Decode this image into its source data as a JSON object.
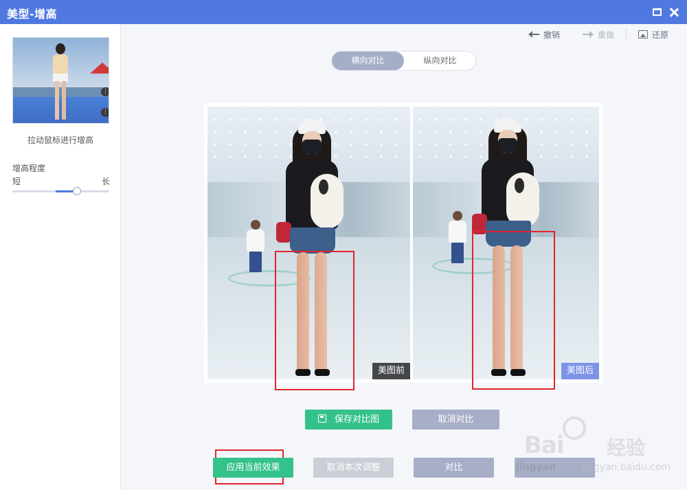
{
  "window": {
    "title": "美型-增高"
  },
  "sidebar": {
    "hint": "拉动鼠标进行增高",
    "degree_label": "增高程度",
    "short_label": "短",
    "long_label": "长",
    "slider_value": 0.68
  },
  "toolbar": {
    "undo": "撤销",
    "redo": "重做",
    "restore": "还原"
  },
  "compare_mode": {
    "horizontal": "横向对比",
    "vertical": "纵向对比",
    "selected": "横向对比"
  },
  "preview": {
    "before_tag": "美图前",
    "after_tag": "美图后"
  },
  "actions": {
    "save_compare": "保存对比图",
    "cancel_compare": "取消对比",
    "apply": "应用当前效果",
    "cancel_adjust": "取消本次调整",
    "compare": "对比"
  },
  "watermark": {
    "brand": "Bai",
    "brand_cn": "经验",
    "url": "jingyan.baidu.com",
    "sub": "jingyan"
  },
  "colors": {
    "titlebar": "#4f79e0",
    "primary_green": "#35c28a",
    "muted_purple": "#a8aec8",
    "highlight_red": "#e0242a"
  }
}
